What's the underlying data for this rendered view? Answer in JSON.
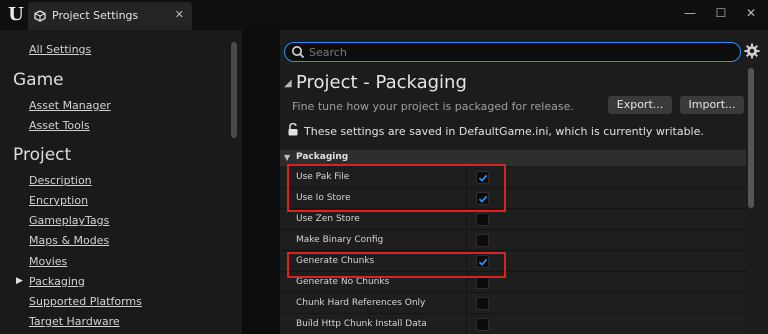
{
  "titlebar": {
    "tab_title": "Project Settings",
    "close_glyph": "✕",
    "minimize_glyph": "—",
    "maximize_glyph": "☐",
    "window_close_glyph": "✕"
  },
  "leftnav": {
    "all_settings": "All Settings",
    "groups": [
      {
        "header": "Game",
        "items": [
          "Asset Manager",
          "Asset Tools"
        ]
      },
      {
        "header": "Project",
        "items": [
          "Description",
          "Encryption",
          "GameplayTags",
          "Maps & Modes",
          "Movies",
          "Packaging",
          "Supported Platforms",
          "Target Hardware"
        ]
      }
    ],
    "selected_item": "Packaging"
  },
  "search": {
    "placeholder": "Search"
  },
  "section": {
    "title": "Project - Packaging",
    "description": "Fine tune how your project is packaged for release.",
    "export_label": "Export...",
    "import_label": "Import...",
    "config_note": "These settings are saved in DefaultGame.ini, which is currently writable."
  },
  "category": {
    "title": "Packaging",
    "rows": [
      {
        "label": "Use Pak File",
        "checked": true,
        "highlighted": true
      },
      {
        "label": "Use Io Store",
        "checked": true,
        "highlighted": true
      },
      {
        "label": "Use Zen Store",
        "checked": false
      },
      {
        "label": "Make Binary Config",
        "checked": false
      },
      {
        "label": "Generate Chunks",
        "checked": true,
        "highlighted": true
      },
      {
        "label": "Generate No Chunks",
        "checked": false
      },
      {
        "label": "Chunk Hard References Only",
        "checked": false
      },
      {
        "label": "Build Http Chunk Install Data",
        "checked": false
      }
    ]
  },
  "colors": {
    "accent": "#2b8ff0",
    "highlight": "#e02020",
    "background": "#151515"
  },
  "icons": {
    "logo": "unreal-engine-logo-icon",
    "tab": "settings-cube-icon",
    "search": "search-icon",
    "gear": "gear-icon",
    "lock": "unlocked-icon"
  }
}
